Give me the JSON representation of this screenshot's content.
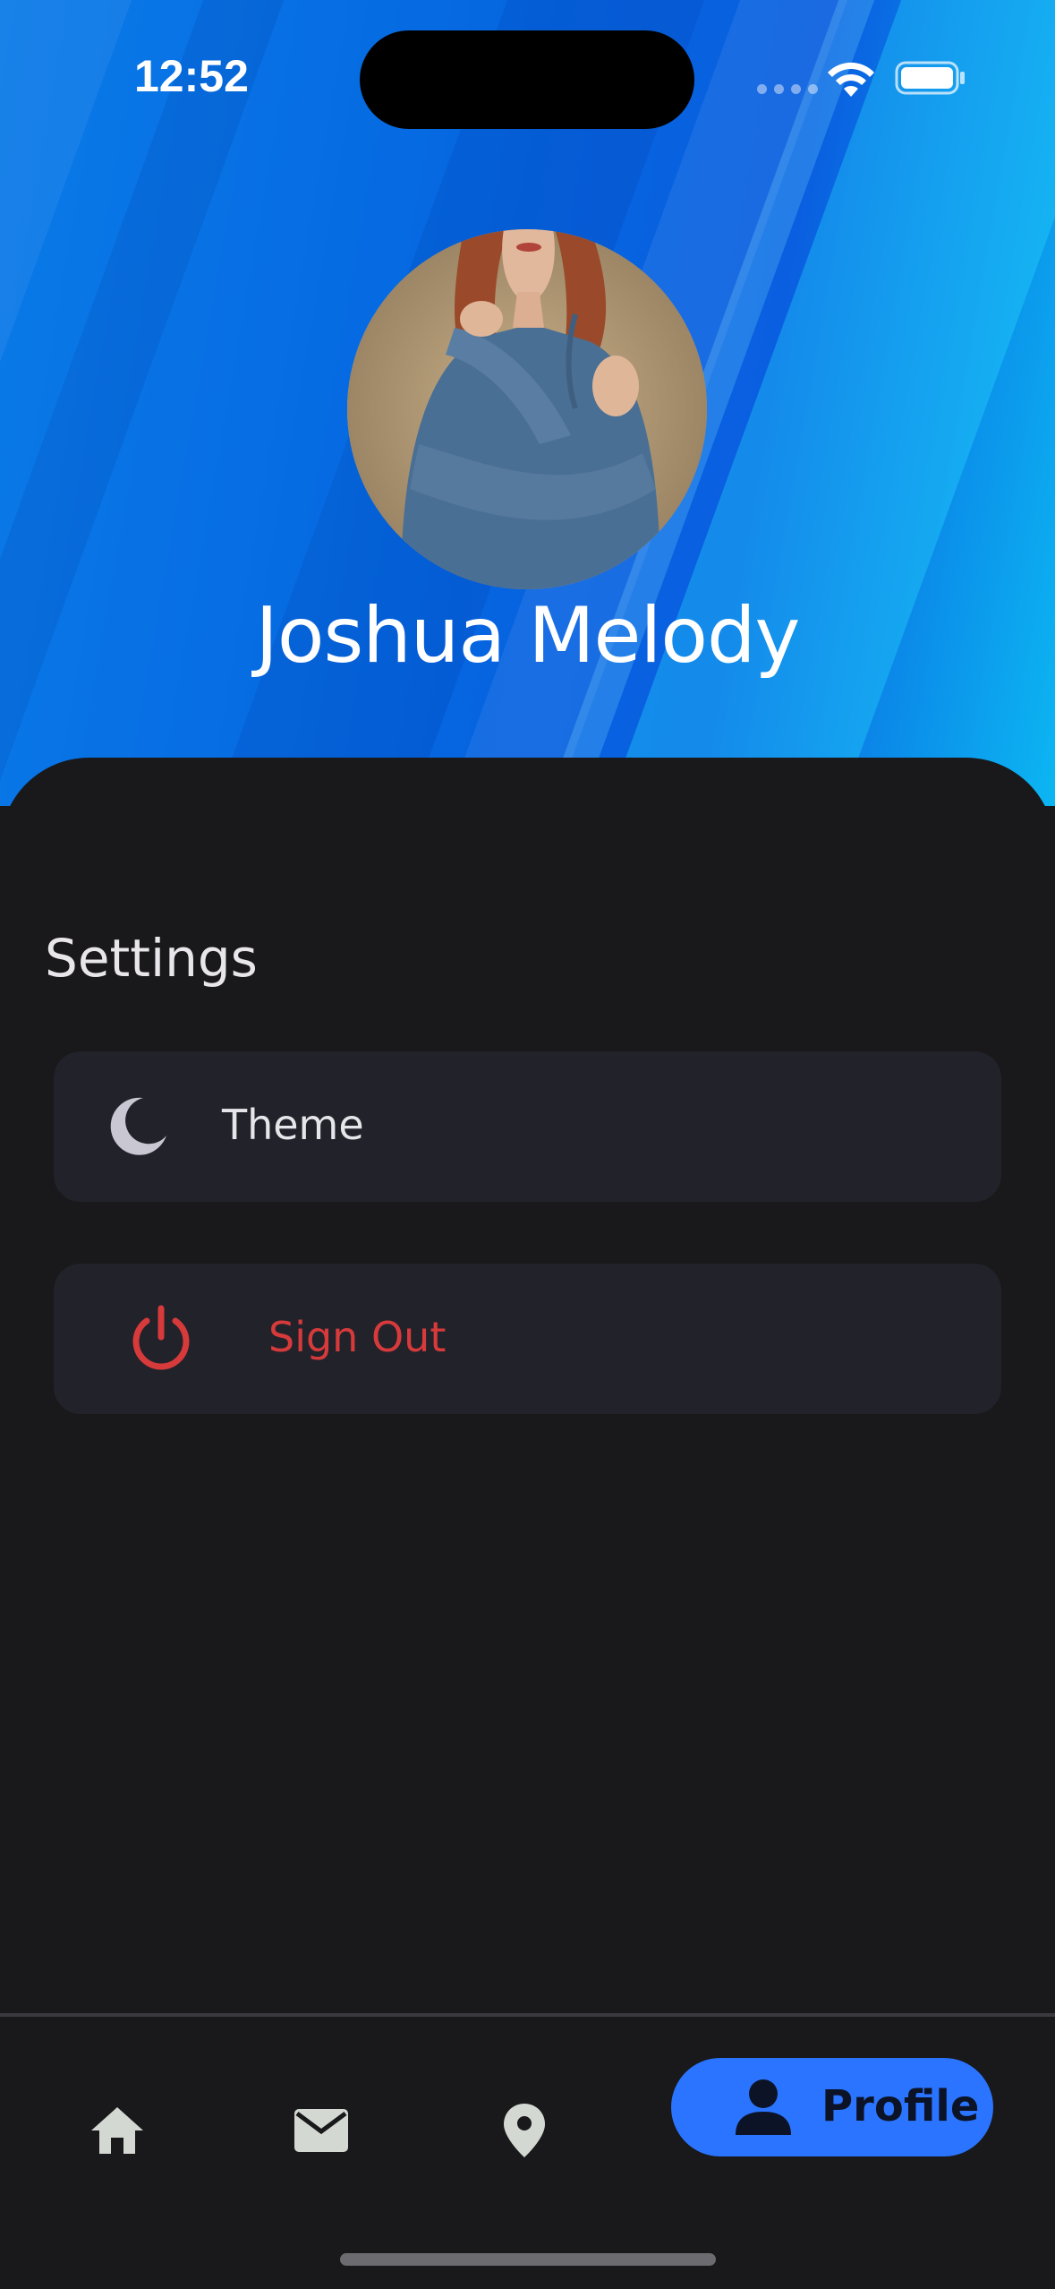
{
  "status_bar": {
    "time": "12:52"
  },
  "profile": {
    "name": "Joshua Melody"
  },
  "settings": {
    "title": "Settings",
    "items": [
      {
        "label": "Theme",
        "icon": "moon-icon"
      },
      {
        "label": "Sign Out",
        "icon": "power-icon",
        "color": "#d63a3a"
      }
    ]
  },
  "bottom_nav": {
    "items": [
      {
        "icon": "home-icon"
      },
      {
        "icon": "mail-icon"
      },
      {
        "icon": "location-pin-icon"
      },
      {
        "icon": "person-icon",
        "label": "Profile",
        "active": true
      }
    ],
    "active_color": "#2a74ff"
  },
  "colors": {
    "header_gradient_start": "#0a7be8",
    "header_gradient_end": "#0cb6f2",
    "background": "#19181a",
    "card": "#22222b",
    "danger": "#d63a3a"
  }
}
